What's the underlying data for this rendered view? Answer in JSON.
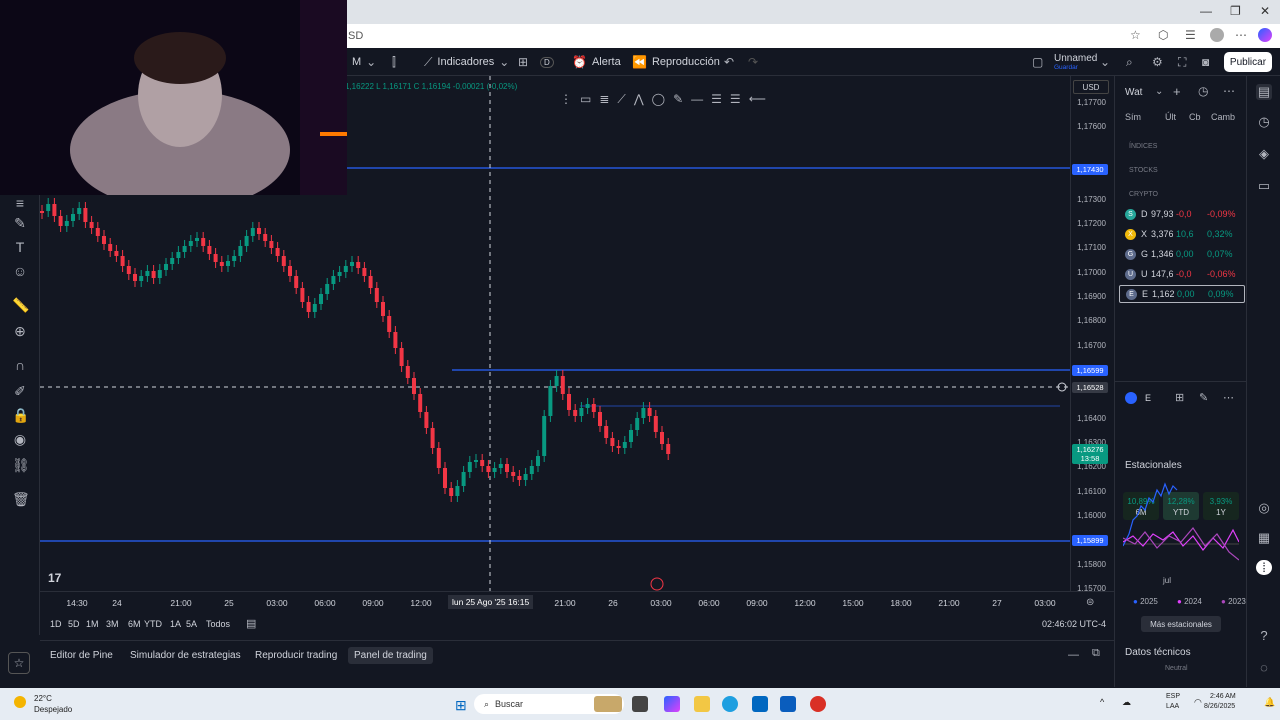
{
  "browser": {
    "address_text": "SD",
    "window_controls": [
      "—",
      "❐",
      "✕"
    ]
  },
  "toolbar": {
    "interval": "M",
    "indicators_label": "Indicadores",
    "alert_label": "Alerta",
    "replay_label": "Reproducción",
    "layout_name": "Unnamed",
    "layout_sub": "Guardar",
    "publish_label": "Publicar",
    "d_badge": "D"
  },
  "ohlc": {
    "text": "1,16222  L 1,16171  C 1,16194  -0,00021 (-0,02%)"
  },
  "price_axis": {
    "currency": "USD",
    "labels": [
      "1,17700",
      "1,17600",
      "1,17300",
      "1,17200",
      "1,17100",
      "1,17000",
      "1,16900",
      "1,16800",
      "1,16700",
      "1,16400",
      "1,16300",
      "1,16200",
      "1,16100",
      "1,16000",
      "1,15800",
      "1,15700"
    ],
    "tags": [
      {
        "text": "1,17430",
        "color": "#2962ff"
      },
      {
        "text": "1,16599",
        "color": "#2962ff"
      },
      {
        "text": "1,16528",
        "color": "#363a45"
      },
      {
        "text": "1,16276",
        "color": "#089981"
      },
      {
        "text": "13:58",
        "color": "#089981"
      },
      {
        "text": "1,15899",
        "color": "#2962ff"
      }
    ]
  },
  "time_axis": {
    "labels": [
      "14:30",
      "24",
      "21:00",
      "25",
      "03:00",
      "06:00",
      "09:00",
      "12:00",
      "21:00",
      "26",
      "03:00",
      "06:00",
      "09:00",
      "12:00",
      "15:00",
      "18:00",
      "21:00",
      "27",
      "03:00"
    ],
    "cursor_tag": "lun 25 Ago '25  16:15"
  },
  "range_bar": {
    "ranges": [
      "1D",
      "5D",
      "1M",
      "3M",
      "6M",
      "YTD",
      "1A",
      "5A",
      "Todos"
    ],
    "clock": "02:46:02 UTC-4"
  },
  "bottom_tabs": [
    "Editor de Pine",
    "Simulador de estrategias",
    "Reproducir trading",
    "Panel de trading"
  ],
  "watchlist": {
    "title": "Wat",
    "columns": [
      "Sím",
      "Últ",
      "Cb",
      "Camb"
    ],
    "sections": [
      "ÍNDICES",
      "STOCKS",
      "CRYPTO"
    ],
    "rows": [
      {
        "sym": "D",
        "last": "97,93",
        "chg": "-0,0",
        "pct": "-0,09%",
        "color": "#f23645",
        "icon": "S",
        "icon_color": "#26a69a"
      },
      {
        "sym": "X",
        "last": "3,376",
        "chg": "10,6",
        "pct": "0,32%",
        "color": "#089981",
        "icon": "X",
        "icon_color": "#f0b90b"
      },
      {
        "sym": "G",
        "last": "1,346",
        "chg": "0,00",
        "pct": "0,07%",
        "color": "#089981",
        "icon": "G",
        "icon_color": "#5d6b8c"
      },
      {
        "sym": "U",
        "last": "147,6",
        "chg": "-0,0",
        "pct": "-0,06%",
        "color": "#f23645",
        "icon": "U",
        "icon_color": "#5d6b8c"
      },
      {
        "sym": "E",
        "last": "1,162",
        "chg": "0,00",
        "pct": "0,09%",
        "color": "#089981",
        "icon": "E",
        "icon_color": "#5d6b8c"
      }
    ],
    "detail_symbol": "E",
    "performance": [
      {
        "value": "10,89%",
        "period": "6M"
      },
      {
        "value": "12,28%",
        "period": "YTD"
      },
      {
        "value": "3,93%",
        "period": "1Y"
      }
    ],
    "seasonal_title": "Estacionales",
    "seasonal_month": "jul",
    "seasonal_years": [
      {
        "year": "2025",
        "color": "#2962ff"
      },
      {
        "year": "2024",
        "color": "#e040fb"
      },
      {
        "year": "2023",
        "color": "#ab47bc"
      }
    ],
    "more_seasonal": "Más estacionales",
    "technical_title": "Datos técnicos",
    "technical_value": "Neutral"
  },
  "taskbar": {
    "weather_temp": "22°C",
    "weather_desc": "Despejado",
    "search_label": "Buscar",
    "lang": "ESP",
    "lang_sub": "LAA",
    "time": "2:46 AM",
    "date": "8/26/2025"
  },
  "colors": {
    "bg": "#131722",
    "up": "#089981",
    "down": "#f23645",
    "line_blue": "#2962ff"
  }
}
